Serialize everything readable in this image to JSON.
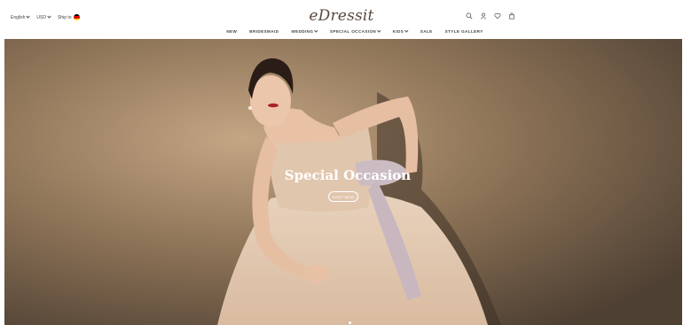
{
  "header": {
    "language": "English",
    "currency": "USD",
    "ship_to_label": "Ship to",
    "flag_colors": [
      "#000000",
      "#dd0000",
      "#ffce00"
    ],
    "logo": "eDressit",
    "icons": [
      "search-icon",
      "user-icon",
      "heart-icon",
      "bag-icon"
    ]
  },
  "nav": {
    "items": [
      {
        "label": "NEW",
        "has_dropdown": false
      },
      {
        "label": "BRIDESMAID",
        "has_dropdown": false
      },
      {
        "label": "WEDDING",
        "has_dropdown": true
      },
      {
        "label": "SPECIAL OCCASION",
        "has_dropdown": true
      },
      {
        "label": "KIDS",
        "has_dropdown": true
      },
      {
        "label": "SALE",
        "has_dropdown": false
      },
      {
        "label": "STYLE GALLERY",
        "has_dropdown": false
      }
    ]
  },
  "hero": {
    "title": "Special Occasion",
    "button_label": "SHOP NOW",
    "slide_indicator_active": 1,
    "colors": {
      "background": "#8f7558",
      "dress": "#e6cdb6",
      "skin": "#e9c2a6"
    }
  }
}
